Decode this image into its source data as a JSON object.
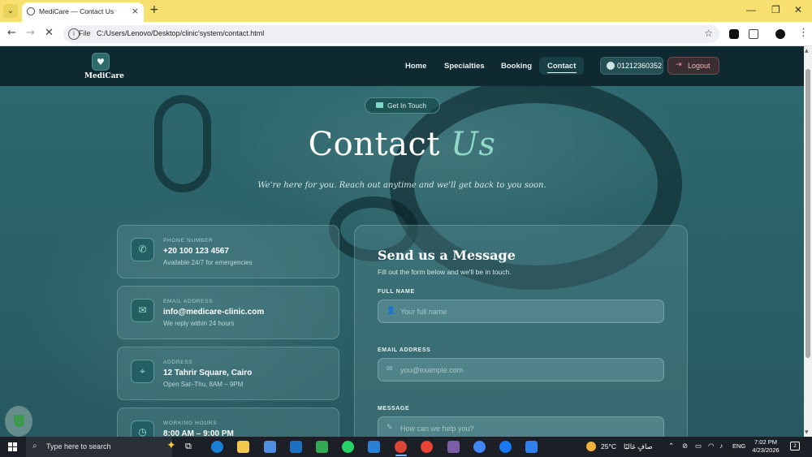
{
  "browser": {
    "tab_title": "MediCare — Contact Us",
    "tab_close": "×",
    "new_tab": "+",
    "url_scheme": "File",
    "url": "C:/Users/Lenovo/Desktop/clinic'system/contact.html"
  },
  "site": {
    "logo_text": "MediCare",
    "nav": [
      "Home",
      "Specialties",
      "Booking",
      "Contact"
    ],
    "user_phone": "01212360352",
    "logout": "Logout"
  },
  "hero": {
    "badge": "Get In Touch",
    "title_main": "Contact",
    "title_accent": "Us",
    "subtitle": "We're here for you. Reach out anytime and we'll get back to you soon."
  },
  "info_cards": [
    {
      "label": "PHONE NUMBER",
      "value": "+20 100 123 4567",
      "note": "Available 24/7 for emergencies",
      "icon": "phone-icon",
      "glyph": "✆"
    },
    {
      "label": "EMAIL ADDRESS",
      "value": "info@medicare-clinic.com",
      "note": "We reply within 24 hours",
      "icon": "mail-icon",
      "glyph": "✉"
    },
    {
      "label": "ADDRESS",
      "value": "12 Tahrir Square, Cairo",
      "note": "Open Sat–Thu, 8AM – 9PM",
      "icon": "location-pin-icon",
      "glyph": "⌖"
    },
    {
      "label": "WORKING HOURS",
      "value": "8:00 AM – 9:00 PM",
      "note": "",
      "icon": "clock-icon",
      "glyph": "◷"
    }
  ],
  "form": {
    "title": "Send us a Message",
    "subtitle": "Fill out the form below and we'll be in touch.",
    "fields": [
      {
        "label": "FULL NAME",
        "placeholder": "Your full name",
        "value": ""
      },
      {
        "label": "EMAIL ADDRESS",
        "placeholder": "you@example.com",
        "value": ""
      },
      {
        "label": "MESSAGE",
        "placeholder": "How can we help you?",
        "value": ""
      }
    ]
  },
  "taskbar": {
    "search_text": "Type here to search",
    "weather": "25°C",
    "weather_desc": "صافٍ غالبًا",
    "lang": "ENG",
    "time": "7:02 PM",
    "date": "4/23/2026"
  },
  "colors": {
    "accent": "#8fd9c8",
    "nav_bg": "#0e2a30",
    "tab_bar": "#f7e06f"
  }
}
